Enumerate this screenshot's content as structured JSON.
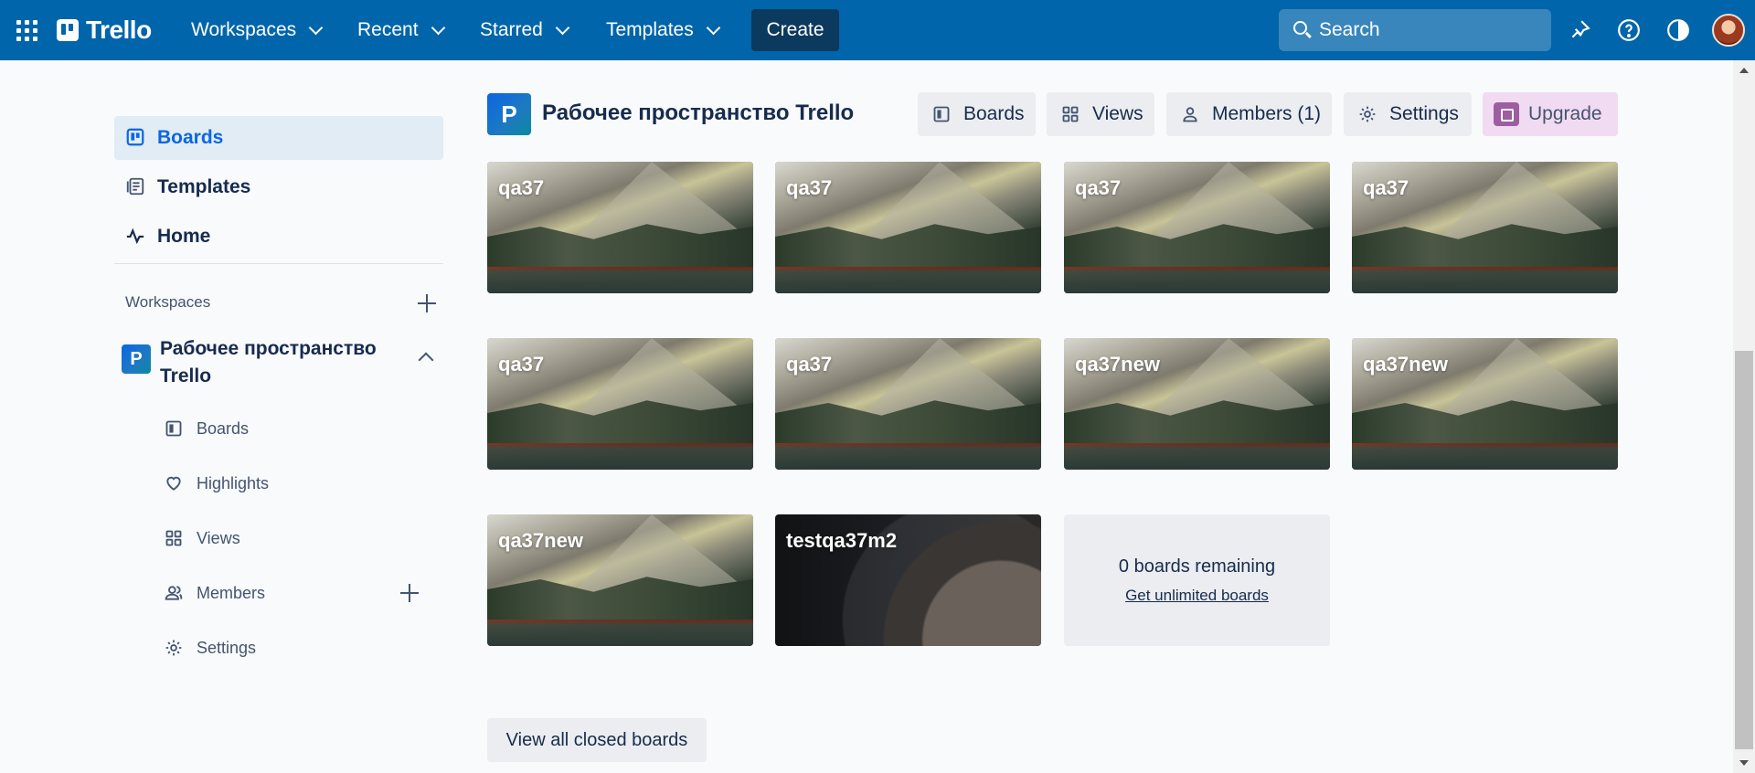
{
  "topbar": {
    "logo_text": "Trello",
    "menus": [
      "Workspaces",
      "Recent",
      "Starred",
      "Templates"
    ],
    "create_label": "Create",
    "search_placeholder": "Search",
    "icons": [
      "apps-grid-icon",
      "notifications-icon",
      "help-icon",
      "theme-toggle-icon"
    ]
  },
  "sidebar": {
    "main_items": [
      {
        "label": "Boards",
        "icon": "board-icon",
        "active": true
      },
      {
        "label": "Templates",
        "icon": "templates-icon",
        "active": false
      },
      {
        "label": "Home",
        "icon": "activity-icon",
        "active": false
      }
    ],
    "workspaces_label": "Workspaces",
    "workspace": {
      "badge": "P",
      "name": "Рабочее пространство Trello",
      "items": [
        {
          "label": "Boards",
          "icon": "board-icon"
        },
        {
          "label": "Highlights",
          "icon": "heart-icon"
        },
        {
          "label": "Views",
          "icon": "grid-icon"
        },
        {
          "label": "Members",
          "icon": "members-icon"
        },
        {
          "label": "Settings",
          "icon": "gear-icon"
        }
      ]
    }
  },
  "main": {
    "workspace_badge": "P",
    "workspace_title": "Рабочее пространство Trello",
    "header_buttons": [
      {
        "label": "Boards",
        "icon": "board-icon"
      },
      {
        "label": "Views",
        "icon": "grid-icon"
      },
      {
        "label": "Members (1)",
        "icon": "person-icon"
      },
      {
        "label": "Settings",
        "icon": "gear-icon"
      },
      {
        "label": "Upgrade",
        "icon": "upgrade-icon"
      }
    ],
    "boards": [
      {
        "title": "qa37",
        "background": "mountain"
      },
      {
        "title": "qa37",
        "background": "mountain"
      },
      {
        "title": "qa37",
        "background": "mountain"
      },
      {
        "title": "qa37",
        "background": "mountain"
      },
      {
        "title": "qa37",
        "background": "mountain"
      },
      {
        "title": "qa37",
        "background": "mountain"
      },
      {
        "title": "qa37new",
        "background": "mountain"
      },
      {
        "title": "qa37new",
        "background": "mountain"
      },
      {
        "title": "qa37new",
        "background": "mountain"
      },
      {
        "title": "testqa37m2",
        "background": "dark"
      }
    ],
    "remaining_text": "0 boards remaining",
    "unlimited_link": "Get unlimited boards",
    "closed_boards_label": "View all closed boards"
  },
  "colors": {
    "topbar": "#0065aa",
    "create_button": "#0c3a5e",
    "sidebar_active_bg": "#e1ecf4",
    "accent": "#0c66e4",
    "upgrade_bg": "#f1dbf2"
  }
}
